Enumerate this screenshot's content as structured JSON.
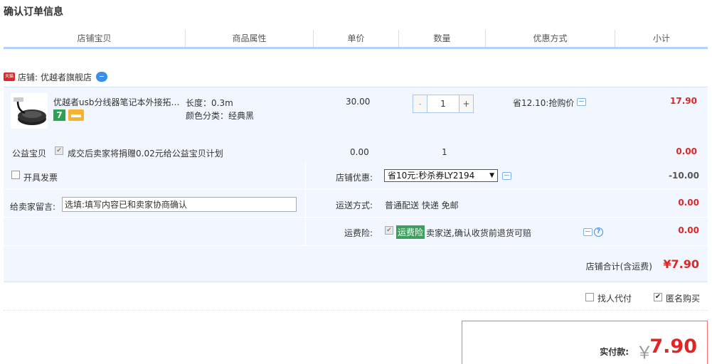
{
  "page": {
    "title": "确认订单信息"
  },
  "columns": [
    {
      "label": "店铺宝贝"
    },
    {
      "label": "商品属性"
    },
    {
      "label": "单价"
    },
    {
      "label": "数量"
    },
    {
      "label": "优惠方式"
    },
    {
      "label": "小计"
    }
  ],
  "shop": {
    "logo_text": "天猫",
    "label": "店铺:",
    "name": "优越者旗舰店"
  },
  "item": {
    "title": "优越者usb分线器笔记本外接拓展坞",
    "badge": "7",
    "attr_length": "长度：0.3m",
    "attr_color": "颜色分类：经典黑",
    "unit_price": "30.00",
    "qty": {
      "minus": "-",
      "value": "1",
      "plus": "+"
    },
    "promo": "省12.10:抢购价",
    "subtotal": "17.90"
  },
  "welfare": {
    "label": "公益宝贝",
    "check": "✔",
    "text": "成交后卖家将捐赠0.02元给公益宝贝计划",
    "price": "0.00",
    "qty": "1",
    "subtotal": "0.00"
  },
  "options": {
    "invoice_label": "开具发票",
    "message_label": "给卖家留言:",
    "message_placeholder": "选填:填写内容已和卖家协商确认",
    "coupon_label": "店铺优惠:",
    "coupon_selected": "省10元:秒杀券LY2194",
    "coupon_arrow": "▼",
    "coupon_amount": "-10.00",
    "shipping_label": "运送方式:",
    "shipping_value": "普通配送 快递 免邮",
    "shipping_amount": "0.00",
    "insurance_label": "运费险:",
    "insurance_check": "✔",
    "insurance_tag": "运费险",
    "insurance_text": "卖家送,确认收货前退货可赔",
    "insurance_amount": "0.00",
    "help": "?"
  },
  "store_total": {
    "label": "店铺合计(含运费)",
    "amount": "¥7.90"
  },
  "extras": {
    "proxy_label": "找人代付",
    "anon_label": "匿名购买",
    "anon_check": "✔"
  },
  "payment": {
    "label": "实付款:",
    "currency": "￥",
    "amount": "7.90"
  },
  "colors": {
    "accent_blue": "#b2d1ff",
    "price_red": "#dd2727",
    "block_bg": "#f2f7ff",
    "tag_green": "#3d9e5e"
  }
}
